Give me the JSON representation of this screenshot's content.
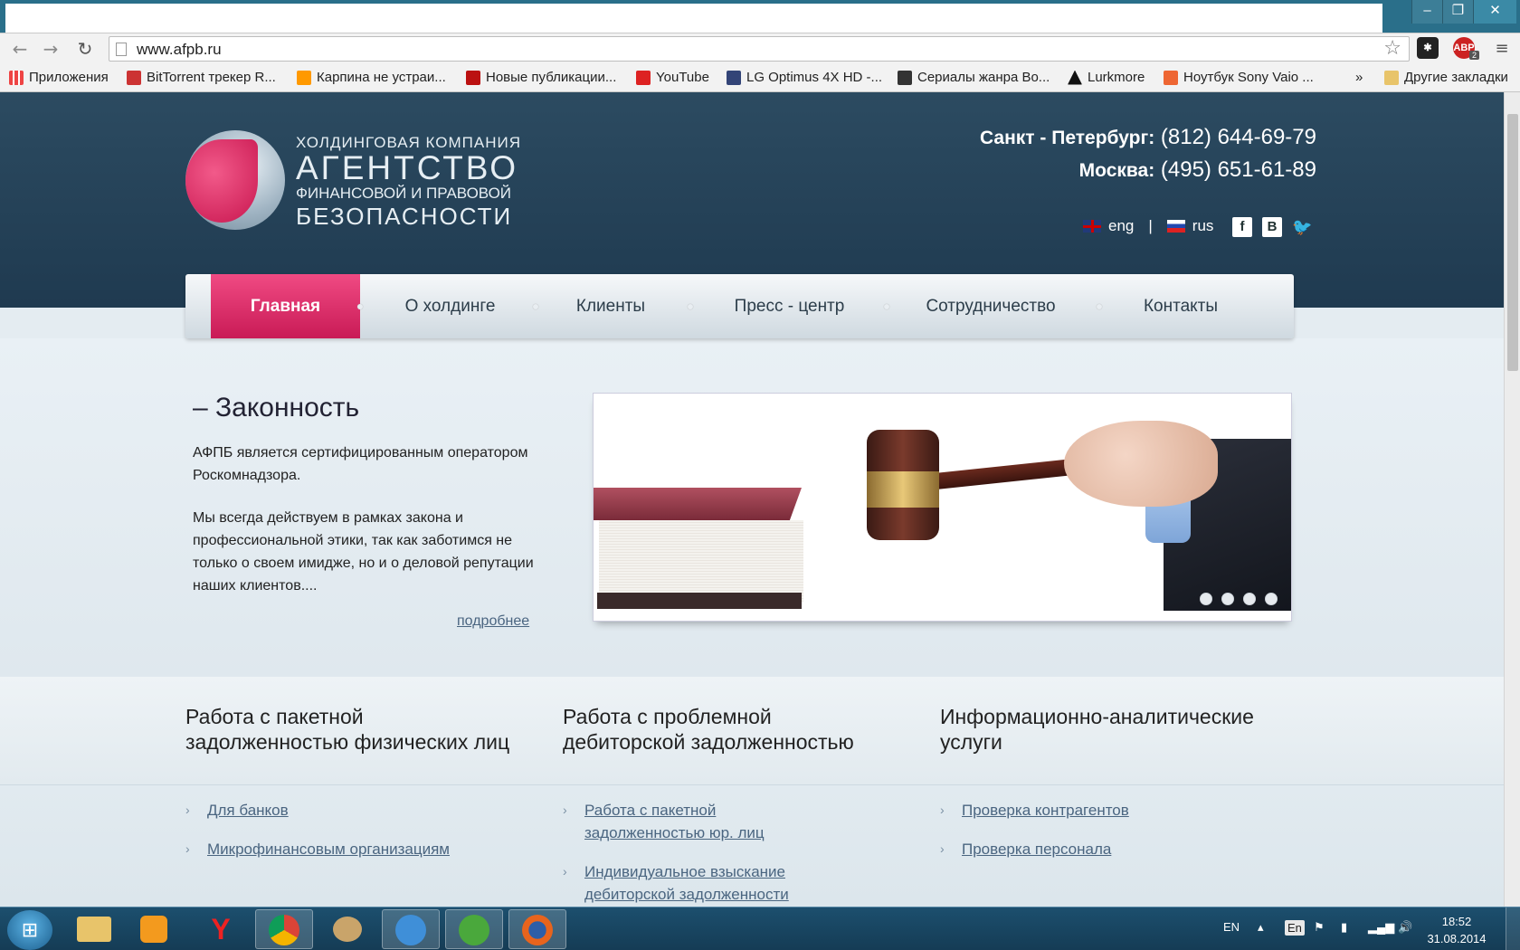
{
  "browser": {
    "url": "www.afpb.ru",
    "window_controls": {
      "minimize": "–",
      "maximize": "❐",
      "close": "✕"
    },
    "abp_badge": "ABP",
    "abp_count": "2",
    "bookmarks": [
      {
        "label": "Приложения",
        "icon": "apps-grid-icon",
        "color": "#e44"
      },
      {
        "label": "BitTorrent трекер R...",
        "icon": "bittorrent-icon",
        "color": "#c33"
      },
      {
        "label": "Карпина не устраи...",
        "icon": "bookmark-orange-icon",
        "color": "#f90"
      },
      {
        "label": "Новые публикации...",
        "icon": "exclamation-icon",
        "color": "#b11"
      },
      {
        "label": "YouTube",
        "icon": "youtube-icon",
        "color": "#d22"
      },
      {
        "label": "LG Optimus 4X HD -...",
        "icon": "4pda-icon",
        "color": "#347"
      },
      {
        "label": "Сериалы жанра Во...",
        "icon": "film-icon",
        "color": "#333"
      },
      {
        "label": "Lurkmore",
        "icon": "lurkmore-icon",
        "color": "#111"
      },
      {
        "label": "Ноутбук Sony Vaio ...",
        "icon": "es-icon",
        "color": "#e63"
      }
    ],
    "bookmarks_more": "»",
    "other_bookmarks": "Другие закладки"
  },
  "site": {
    "logo": {
      "line1": "ХОЛДИНГОВАЯ КОМПАНИЯ",
      "line2": "АГЕНТСТВО",
      "line3": "ФИНАНСОВОЙ И ПРАВОВОЙ",
      "line4": "БЕЗОПАСНОСТИ"
    },
    "phones": [
      {
        "city": "Санкт - Петербург:",
        "number": "(812) 644-69-79"
      },
      {
        "city": "Москва:",
        "number": "(495) 651-61-89"
      }
    ],
    "lang": {
      "eng": "eng",
      "sep": "|",
      "rus": "rus"
    },
    "social": {
      "facebook": "f",
      "vk": "B"
    },
    "nav": [
      "Главная",
      "О холдинге",
      "Клиенты",
      "Пресс - центр",
      "Сотрудничество",
      "Контакты"
    ],
    "feature": {
      "title": "– Законность",
      "p1": "АФПБ является сертифицированным оператором Роскомнадзора.",
      "p2": "Мы всегда действуем в рамках закона и профессиональной этики, так как заботимся не только о своем имидже, но и о деловой репутации наших клиентов....",
      "more": "подробнее"
    },
    "services": [
      {
        "title1": "Работа с пакетной",
        "title2": "задолженностью физических лиц",
        "links": [
          "Для банков",
          "Микрофинансовым организациям"
        ]
      },
      {
        "title1": "Работа с проблемной",
        "title2": "дебиторской задолженностью",
        "links": [
          "Работа с пакетной задолженностью юр. лиц",
          "Индивидуальное взыскание дебиторской задолженности"
        ]
      },
      {
        "title1": "Информационно-аналитические",
        "title2": "услуги",
        "links": [
          "Проверка контрагентов",
          "Проверка персонала"
        ]
      }
    ]
  },
  "taskbar": {
    "lang": "EN",
    "tray_lang": "En",
    "time": "18:52",
    "date": "31.08.2014"
  },
  "colors": {
    "accent": "#e0306a",
    "header": "#1f3a50",
    "link": "#4a6580"
  }
}
